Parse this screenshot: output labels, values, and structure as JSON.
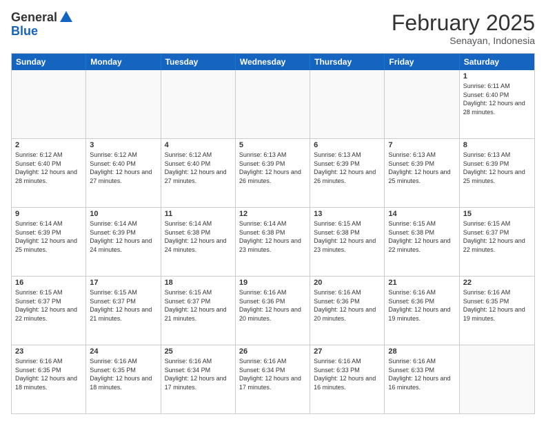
{
  "logo": {
    "general": "General",
    "blue": "Blue"
  },
  "header": {
    "month": "February 2025",
    "location": "Senayan, Indonesia"
  },
  "weekdays": [
    "Sunday",
    "Monday",
    "Tuesday",
    "Wednesday",
    "Thursday",
    "Friday",
    "Saturday"
  ],
  "rows": [
    [
      {
        "day": "",
        "text": ""
      },
      {
        "day": "",
        "text": ""
      },
      {
        "day": "",
        "text": ""
      },
      {
        "day": "",
        "text": ""
      },
      {
        "day": "",
        "text": ""
      },
      {
        "day": "",
        "text": ""
      },
      {
        "day": "1",
        "text": "Sunrise: 6:11 AM\nSunset: 6:40 PM\nDaylight: 12 hours and 28 minutes."
      }
    ],
    [
      {
        "day": "2",
        "text": "Sunrise: 6:12 AM\nSunset: 6:40 PM\nDaylight: 12 hours and 28 minutes."
      },
      {
        "day": "3",
        "text": "Sunrise: 6:12 AM\nSunset: 6:40 PM\nDaylight: 12 hours and 27 minutes."
      },
      {
        "day": "4",
        "text": "Sunrise: 6:12 AM\nSunset: 6:40 PM\nDaylight: 12 hours and 27 minutes."
      },
      {
        "day": "5",
        "text": "Sunrise: 6:13 AM\nSunset: 6:39 PM\nDaylight: 12 hours and 26 minutes."
      },
      {
        "day": "6",
        "text": "Sunrise: 6:13 AM\nSunset: 6:39 PM\nDaylight: 12 hours and 26 minutes."
      },
      {
        "day": "7",
        "text": "Sunrise: 6:13 AM\nSunset: 6:39 PM\nDaylight: 12 hours and 25 minutes."
      },
      {
        "day": "8",
        "text": "Sunrise: 6:13 AM\nSunset: 6:39 PM\nDaylight: 12 hours and 25 minutes."
      }
    ],
    [
      {
        "day": "9",
        "text": "Sunrise: 6:14 AM\nSunset: 6:39 PM\nDaylight: 12 hours and 25 minutes."
      },
      {
        "day": "10",
        "text": "Sunrise: 6:14 AM\nSunset: 6:39 PM\nDaylight: 12 hours and 24 minutes."
      },
      {
        "day": "11",
        "text": "Sunrise: 6:14 AM\nSunset: 6:38 PM\nDaylight: 12 hours and 24 minutes."
      },
      {
        "day": "12",
        "text": "Sunrise: 6:14 AM\nSunset: 6:38 PM\nDaylight: 12 hours and 23 minutes."
      },
      {
        "day": "13",
        "text": "Sunrise: 6:15 AM\nSunset: 6:38 PM\nDaylight: 12 hours and 23 minutes."
      },
      {
        "day": "14",
        "text": "Sunrise: 6:15 AM\nSunset: 6:38 PM\nDaylight: 12 hours and 22 minutes."
      },
      {
        "day": "15",
        "text": "Sunrise: 6:15 AM\nSunset: 6:37 PM\nDaylight: 12 hours and 22 minutes."
      }
    ],
    [
      {
        "day": "16",
        "text": "Sunrise: 6:15 AM\nSunset: 6:37 PM\nDaylight: 12 hours and 22 minutes."
      },
      {
        "day": "17",
        "text": "Sunrise: 6:15 AM\nSunset: 6:37 PM\nDaylight: 12 hours and 21 minutes."
      },
      {
        "day": "18",
        "text": "Sunrise: 6:15 AM\nSunset: 6:37 PM\nDaylight: 12 hours and 21 minutes."
      },
      {
        "day": "19",
        "text": "Sunrise: 6:16 AM\nSunset: 6:36 PM\nDaylight: 12 hours and 20 minutes."
      },
      {
        "day": "20",
        "text": "Sunrise: 6:16 AM\nSunset: 6:36 PM\nDaylight: 12 hours and 20 minutes."
      },
      {
        "day": "21",
        "text": "Sunrise: 6:16 AM\nSunset: 6:36 PM\nDaylight: 12 hours and 19 minutes."
      },
      {
        "day": "22",
        "text": "Sunrise: 6:16 AM\nSunset: 6:35 PM\nDaylight: 12 hours and 19 minutes."
      }
    ],
    [
      {
        "day": "23",
        "text": "Sunrise: 6:16 AM\nSunset: 6:35 PM\nDaylight: 12 hours and 18 minutes."
      },
      {
        "day": "24",
        "text": "Sunrise: 6:16 AM\nSunset: 6:35 PM\nDaylight: 12 hours and 18 minutes."
      },
      {
        "day": "25",
        "text": "Sunrise: 6:16 AM\nSunset: 6:34 PM\nDaylight: 12 hours and 17 minutes."
      },
      {
        "day": "26",
        "text": "Sunrise: 6:16 AM\nSunset: 6:34 PM\nDaylight: 12 hours and 17 minutes."
      },
      {
        "day": "27",
        "text": "Sunrise: 6:16 AM\nSunset: 6:33 PM\nDaylight: 12 hours and 16 minutes."
      },
      {
        "day": "28",
        "text": "Sunrise: 6:16 AM\nSunset: 6:33 PM\nDaylight: 12 hours and 16 minutes."
      },
      {
        "day": "",
        "text": ""
      }
    ]
  ]
}
